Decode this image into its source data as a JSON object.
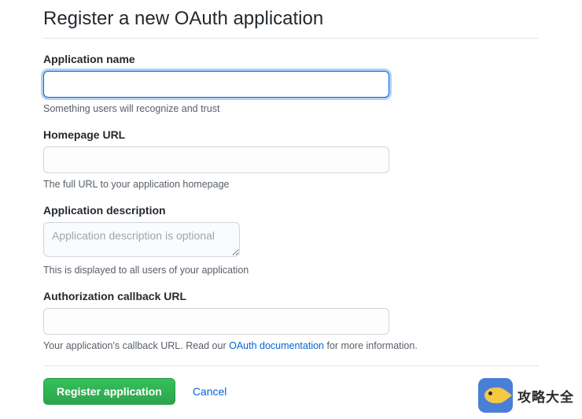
{
  "page": {
    "title": "Register a new OAuth application"
  },
  "form": {
    "app_name": {
      "label": "Application name",
      "value": "",
      "hint": "Something users will recognize and trust"
    },
    "homepage_url": {
      "label": "Homepage URL",
      "value": "",
      "hint": "The full URL to your application homepage"
    },
    "description": {
      "label": "Application description",
      "value": "",
      "placeholder": "Application description is optional",
      "hint": "This is displayed to all users of your application"
    },
    "callback_url": {
      "label": "Authorization callback URL",
      "value": "",
      "hint_prefix": "Your application's callback URL. Read our ",
      "hint_link": "OAuth documentation",
      "hint_suffix": " for more information."
    }
  },
  "actions": {
    "submit": "Register application",
    "cancel": "Cancel"
  },
  "watermark": {
    "text": "攻略大全"
  }
}
